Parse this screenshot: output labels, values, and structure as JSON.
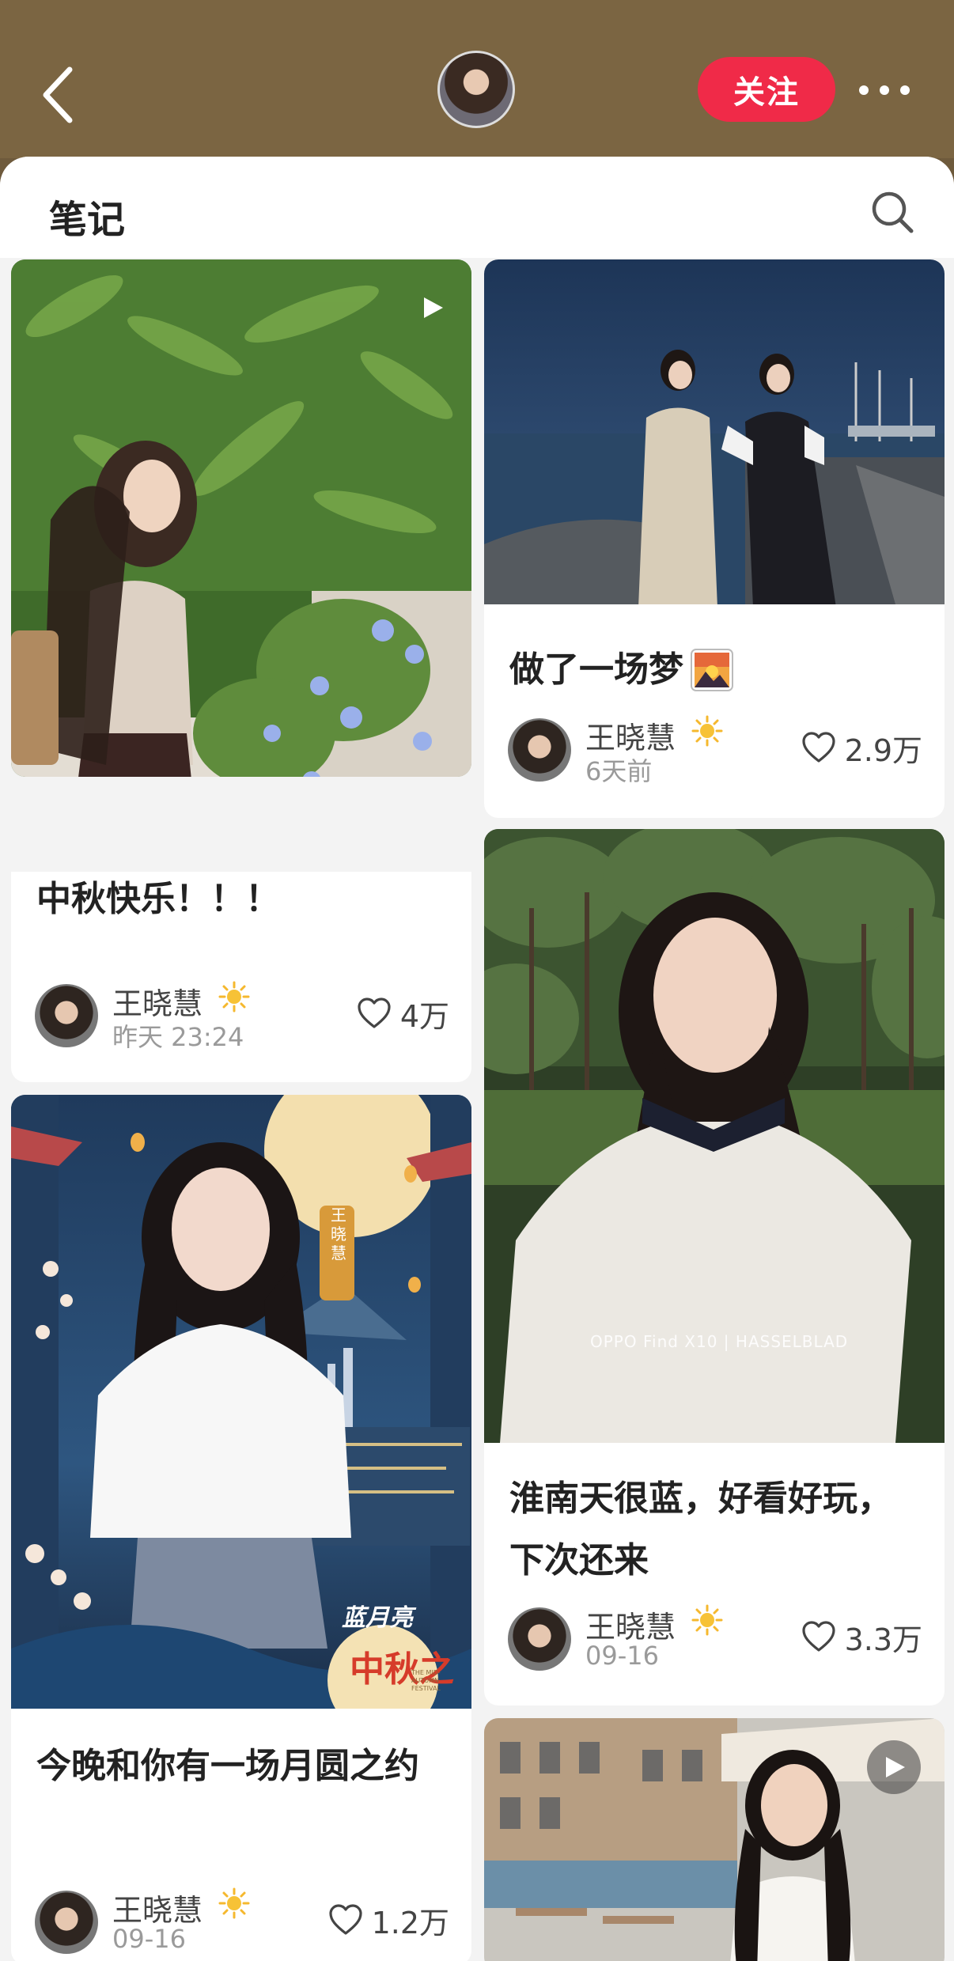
{
  "header": {
    "follow_label": "关注"
  },
  "sheet": {
    "title": "笔记"
  },
  "notes": [
    {
      "title": "中秋快乐！！！",
      "author": "王晓慧",
      "time": "昨天 23:24",
      "likes": "4万",
      "is_video": true
    },
    {
      "title": "做了一场梦",
      "title_emoji": "sunrise-over-mountains-emoji",
      "author": "王晓慧",
      "time": "6天前",
      "likes": "2.9万",
      "is_video": false
    },
    {
      "title": "淮南天很蓝，好看好玩，下次还来",
      "author": "王晓慧",
      "time": "09-16",
      "likes": "3.3万",
      "is_video": false,
      "image_watermark": "OPPO Find X10 | HASSELBLAD"
    },
    {
      "title": "今晚和你有一场月圆之约",
      "author": "王晓慧",
      "time": "09-16",
      "likes": "1.2万",
      "is_video": false,
      "poster_text": [
        "王晓慧",
        "蓝月亮",
        "中秋之",
        "THE MID-AUTUMN FESTIVAL"
      ]
    },
    {
      "title": "",
      "is_video": true
    }
  ],
  "icons": {
    "back": "chevron-left-icon",
    "more": "more-dots-icon",
    "search": "search-icon",
    "like": "heart-outline-icon",
    "badge": "sun-badge-icon",
    "video": "play-icon"
  },
  "colors": {
    "accent": "#f02a48",
    "top_bar": "#7b6542",
    "background": "#f3f3f3"
  }
}
